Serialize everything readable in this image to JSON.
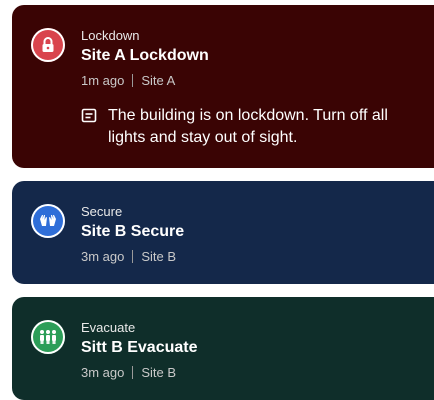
{
  "alerts": [
    {
      "type": "Lockdown",
      "title": "Site A Lockdown",
      "time": "1m ago",
      "site": "Site A",
      "message": "The building is on lockdown. Turn off all lights and stay out of sight.",
      "icon": "padlock-icon",
      "bg_color": "#3a0404",
      "icon_color": "#d9444d"
    },
    {
      "type": "Secure",
      "title": "Site B Secure",
      "time": "3m ago",
      "site": "Site B",
      "icon": "raised-hands-icon",
      "bg_color": "#14284a",
      "icon_color": "#2f6ed8"
    },
    {
      "type": "Evacuate",
      "title": "Sitt B Evacuate",
      "time": "3m ago",
      "site": "Site B",
      "icon": "people-group-icon",
      "bg_color": "#0f2e2a",
      "icon_color": "#2c9e58"
    }
  ]
}
